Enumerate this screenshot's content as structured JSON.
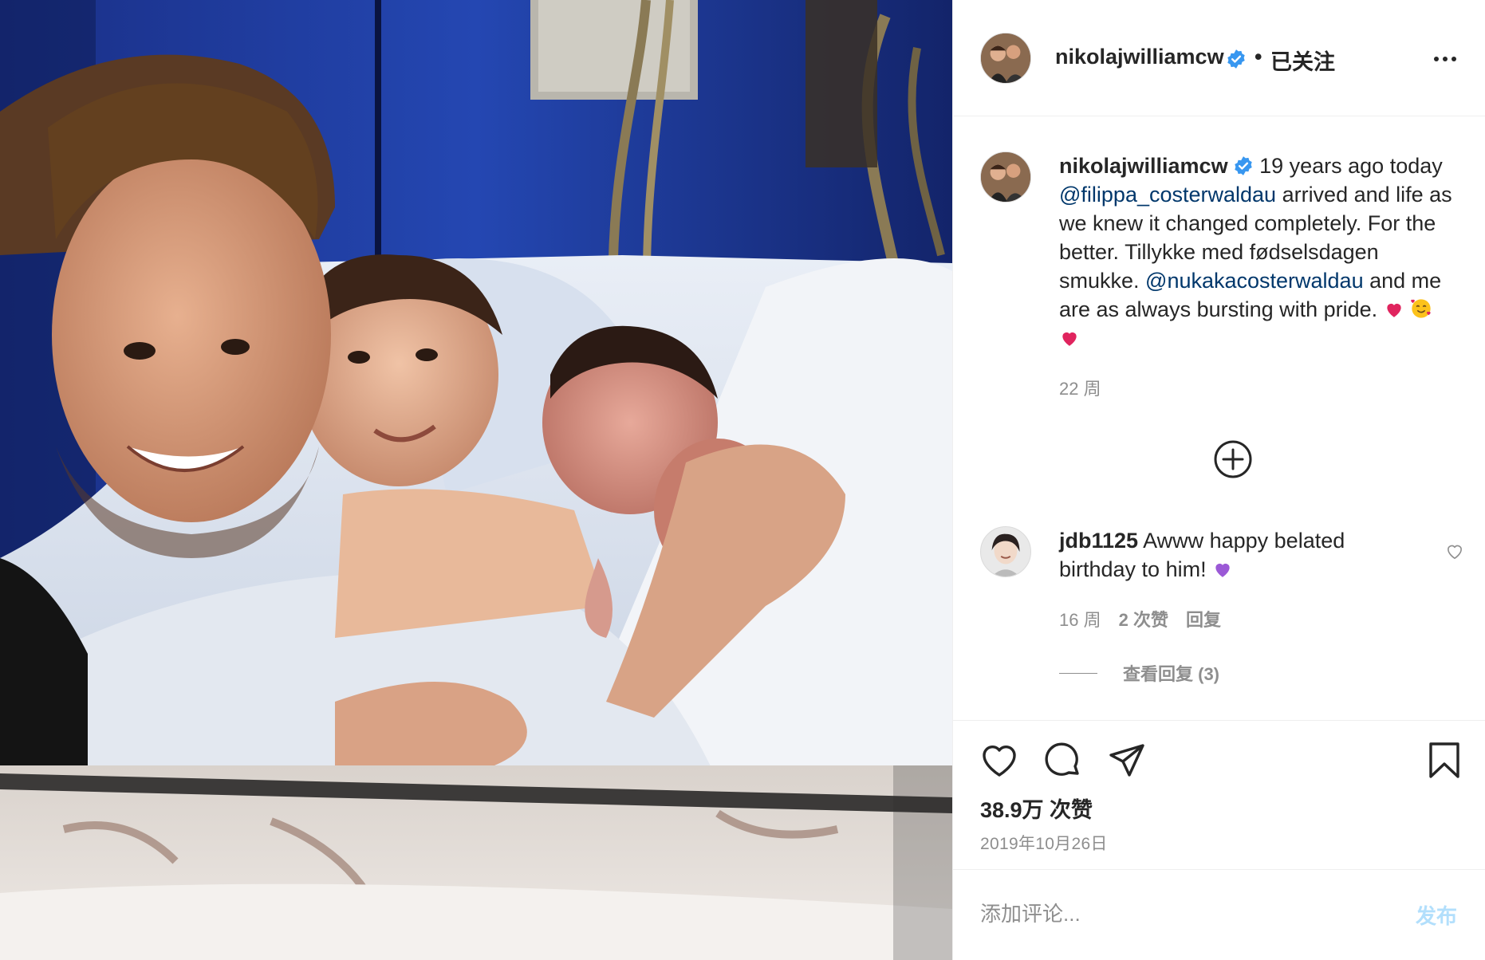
{
  "colors": {
    "accent": "#0095f6",
    "mention": "#00376b",
    "secondary_text": "#8e8e8e",
    "verified": "#3897f0",
    "post_disabled": "#b2dffc",
    "heart_red": "#e0245e",
    "heart_purple": "#9b59d6"
  },
  "header": {
    "username": "nikolajwilliamcw",
    "verified_icon": "verified-badge-icon",
    "separator": "•",
    "follow_status": "已关注",
    "more_icon": "more-options-icon"
  },
  "caption": {
    "username": "nikolajwilliamcw",
    "text_1": " 19 years ago today ",
    "mention_1": "@filippa_costerwaldau",
    "text_2": " arrived and life as we knew it changed completely. For the better. Tillykke med fødselsdagen smukke. ",
    "mention_2": "@nukakacosterwaldau",
    "text_3": " and me are as always bursting with pride. ",
    "emojis": [
      "red-heart",
      "smiling-face-with-hearts",
      "red-heart"
    ],
    "time": "22 周"
  },
  "load_more_icon": "plus-circle-icon",
  "comment": {
    "username": "jdb1125",
    "text": " Awww happy belated birthday to him! ",
    "emoji": "purple-heart",
    "time": "16 周",
    "likes": "2 次赞",
    "reply": "回复",
    "view_replies": "查看回复 (3)"
  },
  "actions": {
    "like_icon": "heart-icon",
    "comment_icon": "comment-icon",
    "share_icon": "paper-plane-icon",
    "save_icon": "bookmark-icon",
    "likes_count": "38.9万 次赞",
    "date": "2019年10月26日"
  },
  "add_comment": {
    "placeholder": "添加评论...",
    "post_label": "发布"
  }
}
